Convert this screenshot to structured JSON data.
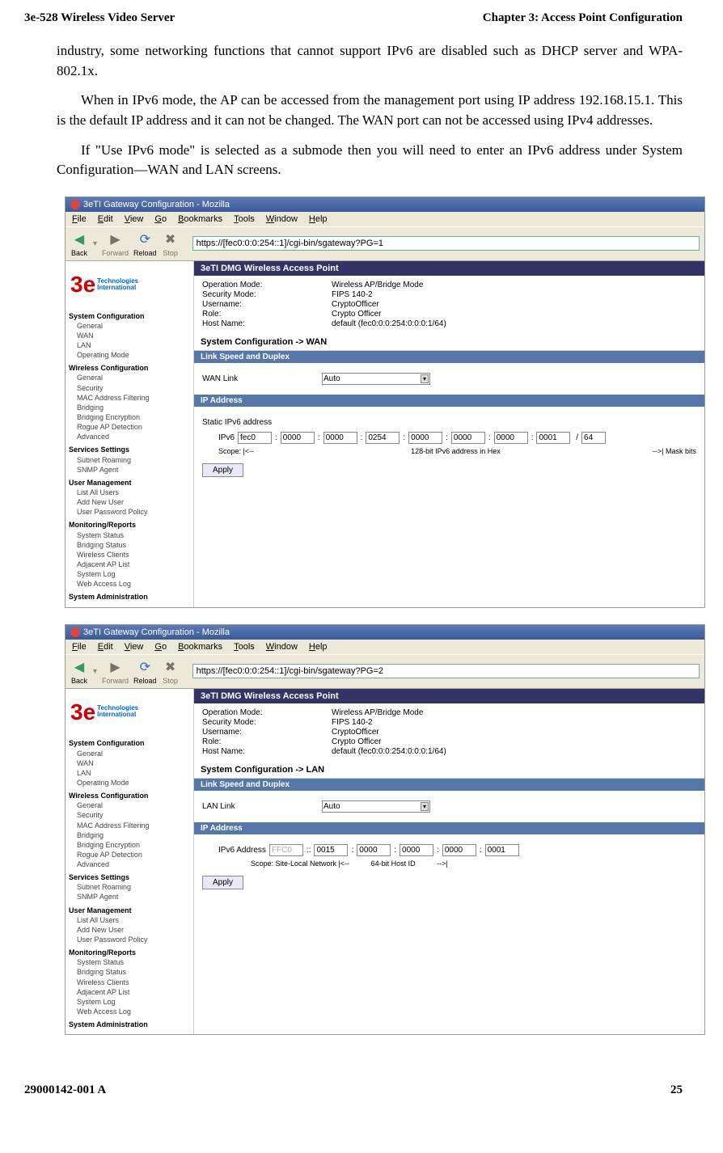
{
  "hdr": {
    "left": "3e-528 Wireless Video Server",
    "right": "Chapter 3: Access Point Configuration"
  },
  "p1": "industry, some networking functions that cannot support IPv6 are disabled such as DHCP server and WPA-802.1x.",
  "p2": "When in IPv6 mode, the AP can be accessed from the management port using IP address 192.168.15.1. This is the default IP address and it can not be changed. The WAN port can not be accessed using IPv4 addresses.",
  "p3": "If \"Use IPv6 mode\" is selected as a submode then you will need to enter an IPv6 address under System Configuration—WAN and LAN screens.",
  "ftr": {
    "left": "29000142-001 A",
    "right": "25"
  },
  "menus": [
    "File",
    "Edit",
    "View",
    "Go",
    "Bookmarks",
    "Tools",
    "Window",
    "Help"
  ],
  "tb": {
    "back": "Back",
    "fwd": "Forward",
    "reload": "Reload",
    "stop": "Stop"
  },
  "s1": {
    "title": "3eTI Gateway Configuration - Mozilla",
    "url": "https://[fec0:0:0:254::1]/cgi-bin/sgateway?PG=1",
    "heading": "3eTI DMG Wireless Access Point",
    "info": [
      [
        "Operation Mode:",
        "Wireless AP/Bridge Mode"
      ],
      [
        "Security Mode:",
        "FIPS 140-2"
      ],
      [
        "Username:",
        "CryptoOfficer"
      ],
      [
        "Role:",
        "Crypto Officer"
      ],
      [
        "Host Name:",
        "default (fec0:0:0:254:0:0:0:1/64)"
      ]
    ],
    "section": "System Configuration -> WAN",
    "sub1": "Link Speed and Duplex",
    "linklbl": "WAN Link",
    "linkval": "Auto",
    "sub2": "IP Address",
    "static": "Static IPv6 address",
    "ipv6": [
      "fec0",
      "0000",
      "0000",
      "0254",
      "0000",
      "0000",
      "0000",
      "0001"
    ],
    "mask": "64",
    "scope": "Scope: |<--",
    "mid": "128-bit IPv6 address in Hex",
    "right": "-->| Mask bits",
    "apply": "Apply"
  },
  "s2": {
    "title": "3eTI Gateway Configuration - Mozilla",
    "url": "https://[fec0:0:0:254::1]/cgi-bin/sgateway?PG=2",
    "heading": "3eTI DMG Wireless Access Point",
    "info": [
      [
        "Operation Mode:",
        "Wireless AP/Bridge Mode"
      ],
      [
        "Security Mode:",
        "FIPS 140-2"
      ],
      [
        "Username:",
        "CryptoOfficer"
      ],
      [
        "Role:",
        "Crypto Officer"
      ],
      [
        "Host Name:",
        "default (fec0:0:0:254:0:0:0:1/64)"
      ]
    ],
    "section": "System Configuration -> LAN",
    "sub1": "Link Speed and Duplex",
    "linklbl": "LAN Link",
    "linkval": "Auto",
    "sub2": "IP Address",
    "prefix": "FFC0",
    "ipv6": [
      "0015",
      "0000",
      "0000",
      "0000",
      "0001"
    ],
    "scope": "Scope:  Site-Local   Network  |<--",
    "mid": "64-bit Host ID",
    "right": "-->|",
    "apply": "Apply"
  },
  "nav": {
    "groups": [
      {
        "t": "System Configuration",
        "i": [
          "General",
          "WAN",
          "LAN",
          "Operating Mode"
        ]
      },
      {
        "t": "Wireless Configuration",
        "i": [
          "General",
          "Security",
          "MAC Address Filtering",
          "Bridging",
          "Bridging Encryption",
          "Rogue AP Detection",
          "Advanced"
        ]
      },
      {
        "t": "Services Settings",
        "i": [
          "Subnet Roaming",
          "SNMP Agent"
        ]
      },
      {
        "t": "User Management",
        "i": [
          "List All Users",
          "Add New User",
          "User Password Policy"
        ]
      },
      {
        "t": "Monitoring/Reports",
        "i": [
          "System Status",
          "Bridging Status",
          "Wireless Clients",
          "Adjacent AP List",
          "System Log",
          "Web Access Log"
        ]
      },
      {
        "t": "System Administration",
        "i": []
      }
    ]
  },
  "logo": {
    "a": "3e",
    "b": "Technologies",
    "c": "International"
  }
}
